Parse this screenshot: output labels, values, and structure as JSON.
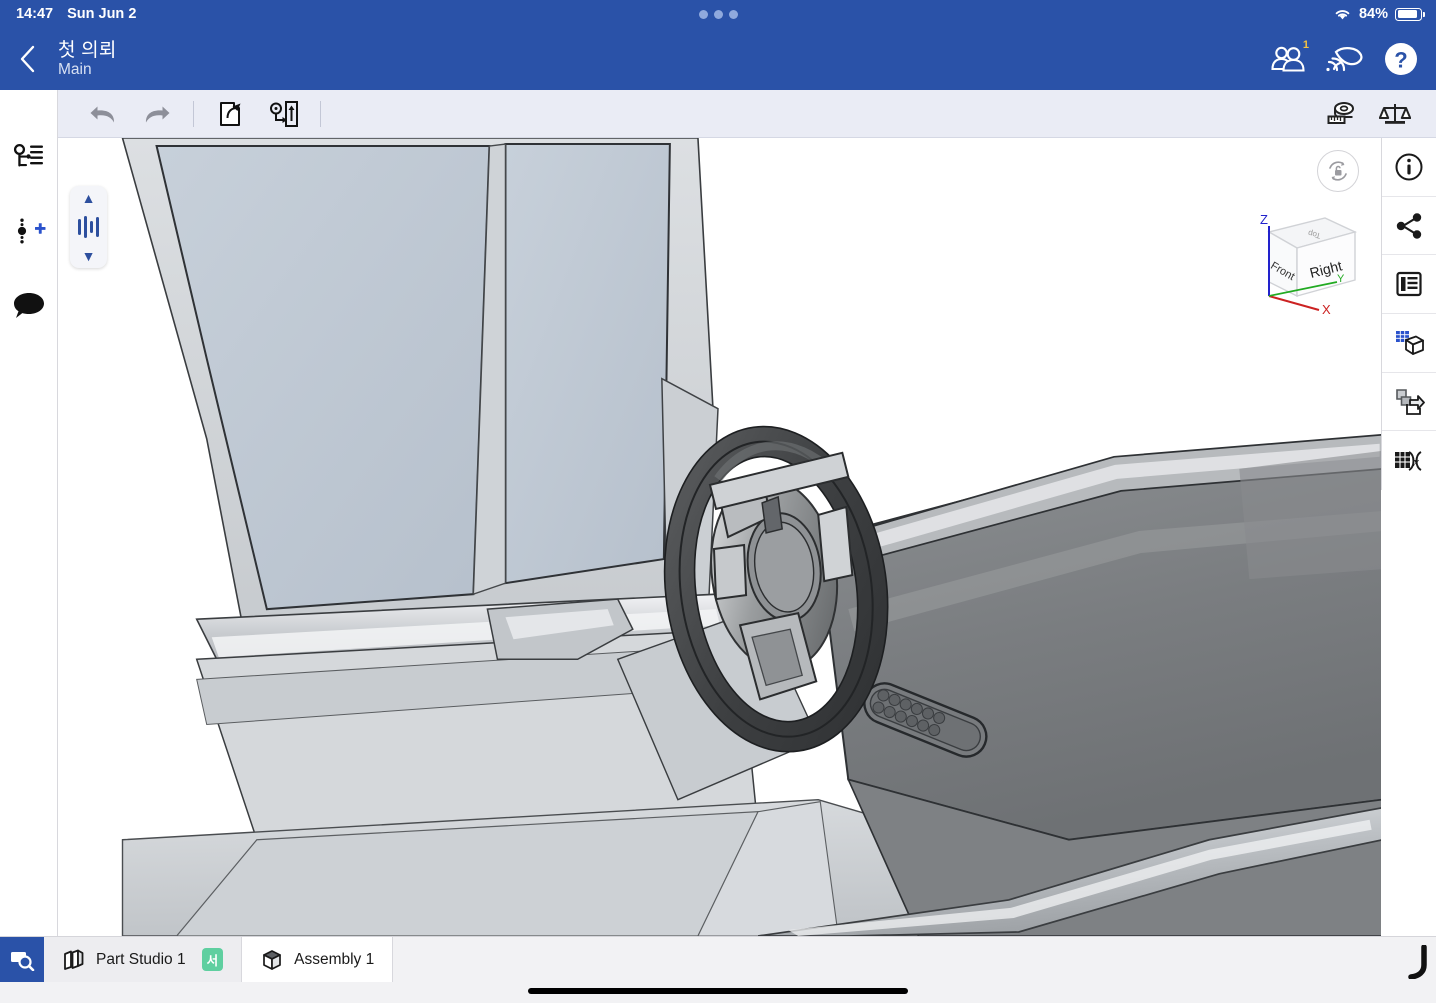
{
  "statusbar": {
    "time": "14:47",
    "date": "Sun Jun 2",
    "battery_percent": "84%",
    "wifi_icon": "wifi-icon",
    "battery_icon": "battery-icon",
    "dots_indicator": "three-dots-icon"
  },
  "header": {
    "back_icon": "chevron-left-icon",
    "title": "첫 의뢰",
    "subtitle": "Main",
    "collaborators_icon": "people-icon",
    "collaborators_count": "1",
    "follow_icon": "follow-mode-icon",
    "help_icon": "help-question-icon",
    "background_color": "#2a52a8"
  },
  "left_rail": {
    "items": [
      {
        "name": "feature-list-icon",
        "label": "Instances list"
      },
      {
        "name": "add-mate-icon",
        "label": "Add mate"
      },
      {
        "name": "comment-icon",
        "label": "Comments"
      }
    ]
  },
  "toolbar": {
    "undo_icon": "undo-arrow-icon",
    "redo_icon": "redo-arrow-icon",
    "insert_icon": "insert-part-icon",
    "mate_icon": "mate-connector-icon",
    "measure_icon": "measure-tape-icon",
    "mass_icon": "mass-properties-scale-icon",
    "background_color": "#eaecf5"
  },
  "right_rail": {
    "items": [
      {
        "name": "info-icon",
        "label": "Details"
      },
      {
        "name": "share-icon",
        "label": "Share"
      },
      {
        "name": "bill-of-materials-icon",
        "label": "Bill of materials"
      },
      {
        "name": "appearance-cube-icon",
        "label": "Display state"
      },
      {
        "name": "export-copy-icon",
        "label": "Export"
      },
      {
        "name": "variables-table-icon",
        "label": "Variables"
      }
    ]
  },
  "viewport": {
    "explode_slider": {
      "up_chevron": "chevron-up-icon",
      "down_chevron": "chevron-down-icon",
      "handle_icon": "explode-slider-icon"
    },
    "rotate_button_icon": "rotate-lock-icon",
    "view_cube": {
      "front_label": "Front",
      "right_label": "Right",
      "top_label": "Top",
      "axis_x": "X",
      "axis_y": "Y",
      "axis_z": "Z",
      "x_color": "#cc2222",
      "y_color": "#22aa22",
      "z_color": "#2222cc"
    },
    "model_description": "Van interior assembly: driver door with window glass, steering wheel, dashboard with speaker grille, center console",
    "colors": {
      "glass": "#bfc8d2",
      "body_light": "#d3d6d9",
      "dashboard": "#7c7f82",
      "wheel_rim": "#4a4c4e"
    }
  },
  "tabbar": {
    "search_icon": "zoom-to-fit-icon",
    "tabs": [
      {
        "label": "Part Studio 1",
        "icon": "part-studio-icon",
        "badge": "서",
        "badge_color": "#5fcfa0",
        "active": false
      },
      {
        "label": "Assembly 1",
        "icon": "assembly-cube-icon",
        "badge": null,
        "active": true
      }
    ],
    "home_indicator": "home-indicator-bar",
    "corner_icon": "corner-hook-icon"
  }
}
